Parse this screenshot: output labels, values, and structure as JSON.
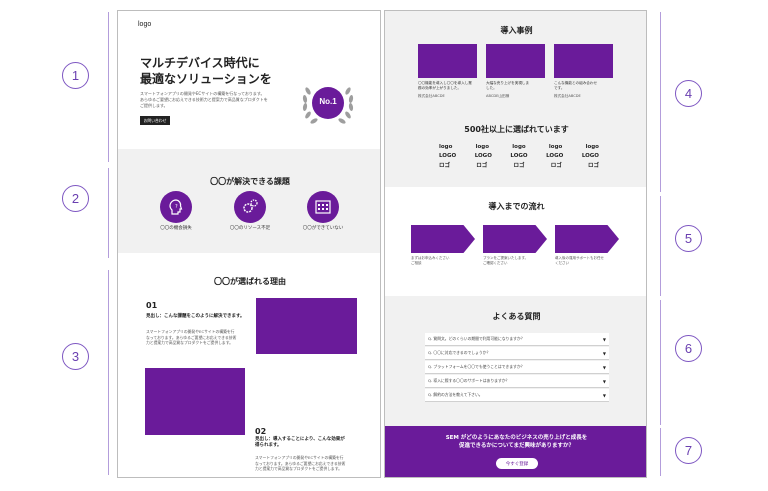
{
  "annotations": [
    "1",
    "2",
    "3",
    "4",
    "5",
    "6",
    "7"
  ],
  "left": {
    "logo": "logo",
    "hero": {
      "title_line1": "マルチデバイス時代に",
      "title_line2": "最適なソリューションを",
      "desc_line1": "スマートフォンアプリの開発やECサイトの構築を行なっております。",
      "desc_line2": "あらゆるご要望にお応えできる技術力と提案力で高品質なプロダクトを",
      "desc_line3": "ご提供します。",
      "cta": "お問い合わせ",
      "badge": "No.1"
    },
    "issues": {
      "heading": "〇〇が解決できる課題",
      "items": [
        {
          "label": "〇〇の機会損失"
        },
        {
          "label": "〇〇のリソース不足"
        },
        {
          "label": "〇〇ができていない"
        }
      ]
    },
    "reasons": {
      "heading": "〇〇が選ばれる理由",
      "r1": {
        "num": "01",
        "title": "見出し：こんな課題をこのように解決できます。",
        "body1": "スマートフォンアプリの開発やECサイトの構築を行",
        "body2": "なっております。あらゆるご要望にお応えできる技術",
        "body3": "力と提案力で高品質なプロダクトをご提供します。"
      },
      "r2": {
        "num": "02",
        "title1": "見出し：導入することにより、こんな効果が",
        "title2": "得られます。",
        "body1": "スマートフォンアプリの開発やECサイトの構築を行",
        "body2": "なっております。あらゆるご要望にお応えできる技術",
        "body3": "力と提案力で高品質なプロダクトをご提供します。"
      }
    }
  },
  "right": {
    "cases": {
      "heading": "導入事例",
      "items": [
        {
          "text1": "〇〇機能を導入し〇〇を導入し業",
          "text2": "務の効率が上がりました。",
          "company": "株式会社ABCDE"
        },
        {
          "text1": "大幅な売り上げを実現しま",
          "text2": "した。",
          "company": "ABCDE山田様"
        },
        {
          "text1": "こんな機能との組み合わせ",
          "text2": "です。",
          "company": "株式会社ABCDE"
        }
      ]
    },
    "clients": {
      "heading": "500社以上に選ばれています",
      "rows": [
        [
          "logo",
          "logo",
          "logo",
          "logo",
          "logo"
        ],
        [
          "LOGO",
          "LOGO",
          "LOGO",
          "LOGO",
          "LOGO"
        ],
        [
          "ロゴ",
          "ロゴ",
          "ロゴ",
          "ロゴ",
          "ロゴ"
        ]
      ]
    },
    "flow": {
      "heading": "導入までの流れ",
      "steps": [
        {
          "text1": "まずはお申込みください",
          "text2": "ご相談"
        },
        {
          "text1": "プランをご提案いたします。",
          "text2": "ご確認ください"
        },
        {
          "text1": "導入後の運用サポートもお任せ",
          "text2": "ください"
        }
      ]
    },
    "faq": {
      "heading": "よくある質問",
      "items": [
        "Q. 質問文。どのくらいの期間で利用可能になりますか？",
        "Q. 〇〇に対応できるのでしょうか？",
        "Q. プラットフォームを〇〇でも使うことはできますか？",
        "Q. 導入に際する〇〇のサポートはありますか？",
        "Q. 解約の方法を教えて下さい。"
      ]
    },
    "cta": {
      "line1": "SEM がどのようにあなたのビジネスの売り上げと成長を",
      "line2": "促進できるかについてまだ興味がありますか？",
      "button": "今すぐ登録"
    }
  }
}
